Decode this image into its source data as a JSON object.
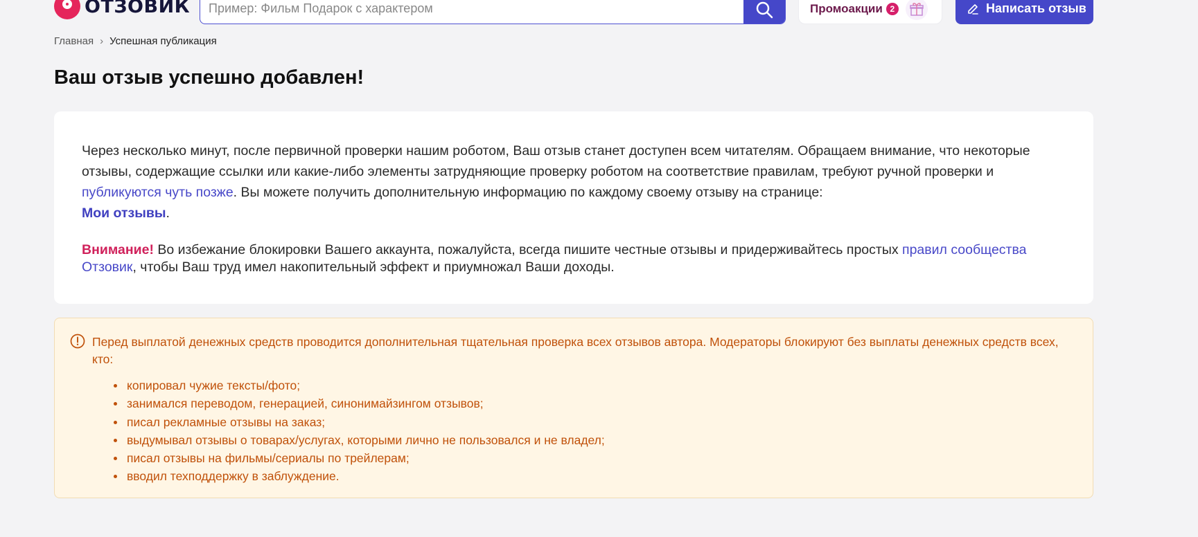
{
  "header": {
    "logo_text": "ОТЗОВИК",
    "search": {
      "placeholder": "Пример: Фильм Подарок с характером",
      "value": ""
    },
    "promo": {
      "label": "Промоакции",
      "badge": "2"
    },
    "write_review_label": "Написать отзыв"
  },
  "breadcrumb": {
    "home": "Главная",
    "separator": "›",
    "current": "Успешная публикация"
  },
  "page_title": "Ваш отзыв успешно добавлен!",
  "card": {
    "p1_part1": "Через несколько минут, после первичной проверки нашим роботом, Ваш отзыв станет доступен всем читателям. Обращаем внимание, что некоторые отзывы, содержащие ссылки или какие-либо элементы затрудняющие проверку роботом на соответствие правилам, требуют ручной проверки и ",
    "p1_link": "публикуются чуть позже",
    "p1_part2": ". Вы можете получить дополнительную информацию по каждому своему отзыву на странице: ",
    "p1_link2": "Мои отзывы",
    "p1_end": ".",
    "p2_warn": "Внимание!",
    "p2_part1": " Во избежание блокировки Вашего аккаунта, пожалуйста, всегда пишите честные отзывы и придерживайтесь простых ",
    "p2_link": "правил сообщества Отзовик",
    "p2_part2": ", чтобы Ваш труд имел накопительный эффект и приумножал Ваши доходы."
  },
  "notice": {
    "text": "Перед выплатой денежных средств проводится дополнительная тщательная проверка всех отзывов автора. Модераторы блокируют без выплаты денежных средств всех, кто:",
    "items": [
      "копировал чужие тексты/фото;",
      "занимался переводом, генерацией, синонимайзингом отзывов;",
      "писал рекламные отзывы на заказ;",
      "выдумывал отзывы о товарах/услугах, которыми лично не пользовался и не владел;",
      "писал отзывы на фильмы/сериалы по трейлерам;",
      "вводил техподдержку в заблуждение."
    ]
  },
  "colors": {
    "accent": "#4547c9",
    "brand": "#e5255b",
    "warning_text": "#c0510a",
    "warning_bg": "#fff6e5",
    "attention": "#d0215b"
  }
}
